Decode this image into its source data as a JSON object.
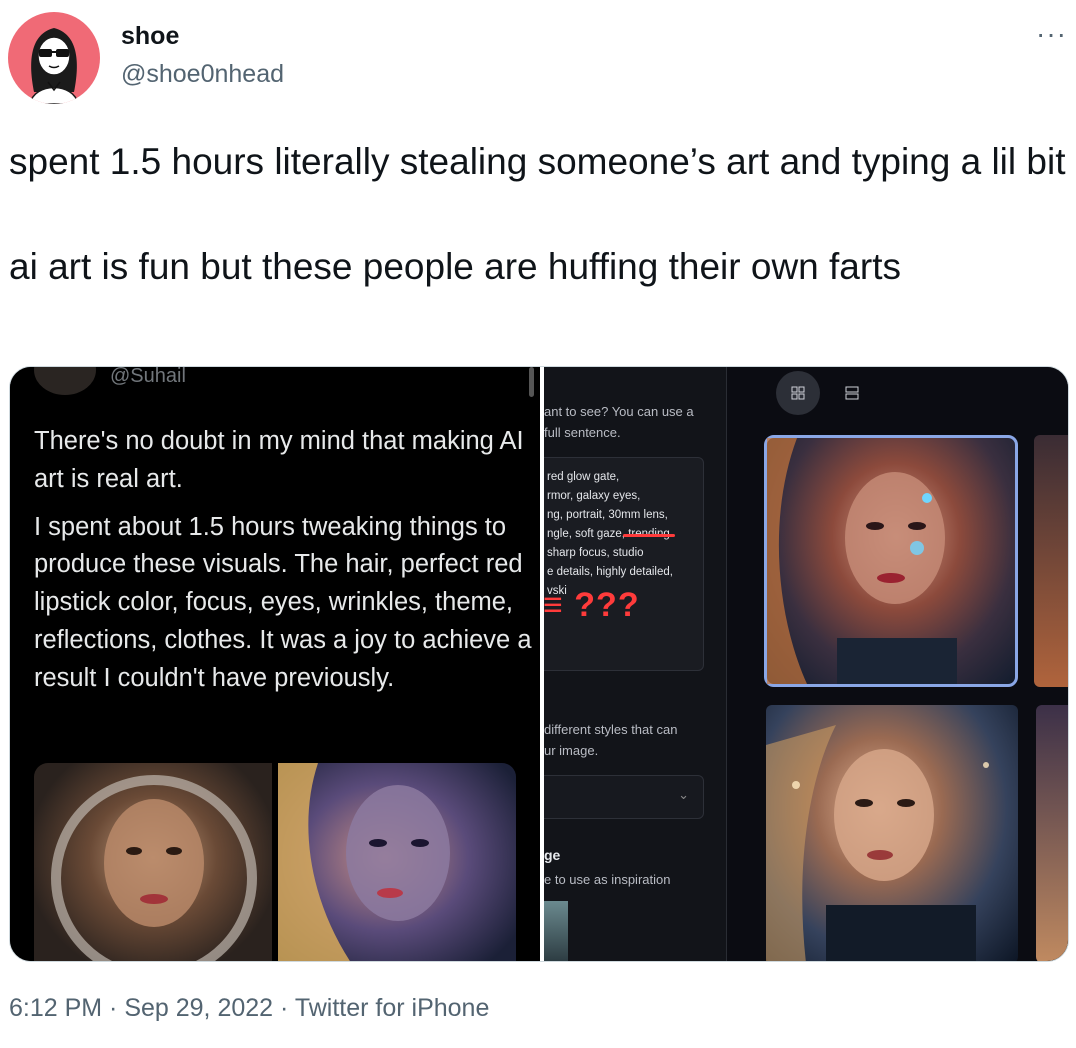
{
  "tweet": {
    "display_name": "shoe",
    "handle": "@shoe0nhead",
    "more_icon": "more-horizontal-icon",
    "paragraphs": [
      "spent 1.5 hours literally stealing someone’s art and typing a lil bit",
      "ai art is fun but these people are huffing their own farts"
    ],
    "timestamp": "6:12 PM · Sep 29, 2022 · Twitter for iPhone"
  },
  "left_screenshot": {
    "handle": "@Suhail",
    "paragraphs": [
      "There's no doubt in my mind that making AI art is real art.",
      "I spent about 1.5 hours tweaking things to produce these visuals. The hair, perfect red lipstick color, focus, eyes, wrinkles, theme, reflections, clothes. It was a joy to achieve a result I couldn't have previously."
    ]
  },
  "right_screenshot": {
    "prompt_help": [
      "ant to see? You can use a",
      "full sentence."
    ],
    "prompt_lines": [
      "red glow gate,",
      "rmor, galaxy eyes,",
      "ng, portrait, 30mm lens,",
      "ngle, soft gaze, trending",
      "sharp focus, studio",
      "e details, highly detailed,",
      "vski"
    ],
    "annotation": "≡ ???",
    "styles_help": [
      "different styles that can",
      "ur image."
    ],
    "image_section_title": "ge",
    "image_section_help": "e to use as inspiration",
    "grid_view_icon": "grid-view-icon",
    "list_view_icon": "list-view-icon",
    "select_chevron": "⌄"
  },
  "colors": {
    "link_gray": "#536471",
    "avatar_pink": "#f06a76",
    "annotation_red": "#ff3b3b",
    "selected_border": "#8aa7e6"
  }
}
